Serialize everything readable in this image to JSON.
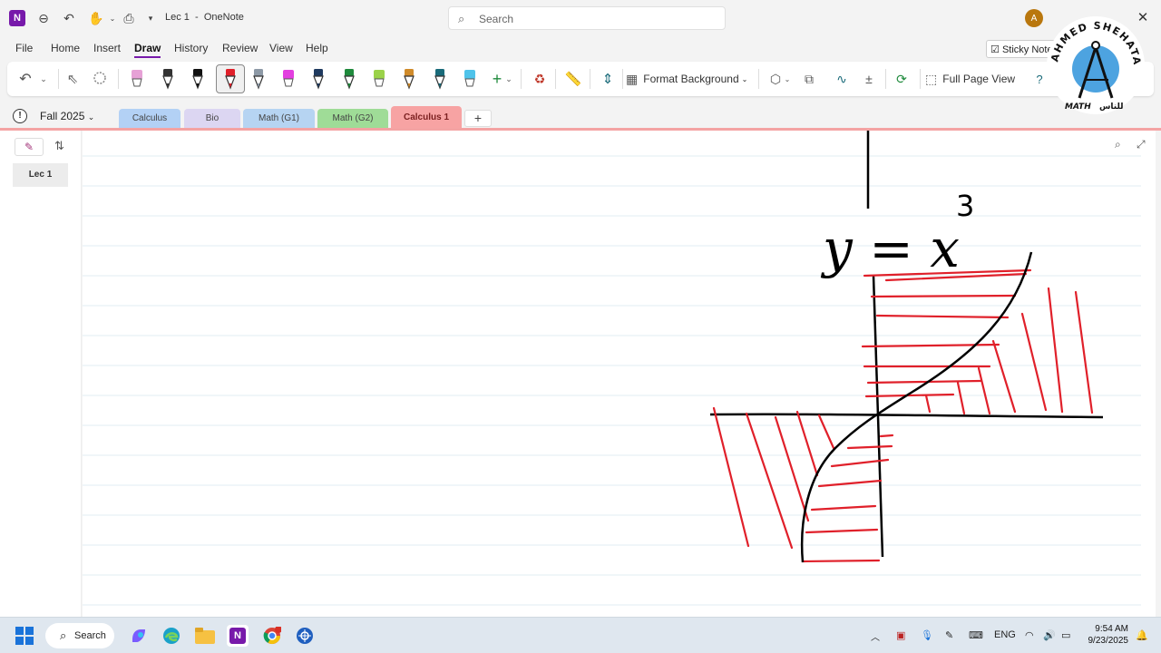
{
  "window": {
    "title": "Lec 1",
    "title_separator": "-",
    "app_name": "OneNote",
    "search_placeholder": "Search",
    "avatar_initial": "A"
  },
  "menu": [
    "File",
    "Home",
    "Insert",
    "Draw",
    "History",
    "Review",
    "View",
    "Help"
  ],
  "active_menu": "Draw",
  "sticky_notes_label": "Sticky Notes",
  "ribbon": {
    "format_background_label": "Format Background",
    "full_page_view_label": "Full Page View",
    "pens": [
      {
        "name": "pink-highlighter",
        "color": "#e6a1d6"
      },
      {
        "name": "black-pen-outline",
        "color": "#333333"
      },
      {
        "name": "black-pen",
        "color": "#111111"
      },
      {
        "name": "red-pen",
        "color": "#e0202a"
      },
      {
        "name": "gray-pen",
        "color": "#8d99a6"
      },
      {
        "name": "magenta-highlighter",
        "color": "#e33fe0"
      },
      {
        "name": "navy-pen",
        "color": "#1f3a5f"
      },
      {
        "name": "green-pen",
        "color": "#1f8a3c"
      },
      {
        "name": "lime-highlighter",
        "color": "#9bd24a"
      },
      {
        "name": "galaxy-pen",
        "color": "#d08b2a"
      },
      {
        "name": "teal-pen",
        "color": "#1a6b7a"
      },
      {
        "name": "cyan-highlighter",
        "color": "#4fc3ea"
      }
    ]
  },
  "notebook": {
    "name": "Fall 2025",
    "sections": [
      {
        "label": "Calculus",
        "color": "#b3d1f5"
      },
      {
        "label": "Bio",
        "color": "#dcd6f2"
      },
      {
        "label": "Math (G1)",
        "color": "#b6d4f2"
      },
      {
        "label": "Math (G2)",
        "color": "#9fdc97"
      },
      {
        "label": "Calculus 1",
        "color": "#f7a3a3"
      }
    ],
    "active_section": "Calculus 1",
    "add_section_label": "+"
  },
  "pages": [
    "Lec 1"
  ],
  "canvas": {
    "formula_main": "y = x",
    "formula_exponent": "3"
  },
  "brand": {
    "name": "AHMED SHEHATA",
    "sub_left": "MATH",
    "sub_right": "للناس"
  },
  "taskbar": {
    "search_label": "Search",
    "language": "ENG",
    "time": "9:54 AM",
    "date": "9/23/2025"
  },
  "colors": {
    "accent": "#7719aa",
    "ink_red": "#e0202a",
    "ink_black": "#000000",
    "rule_line": "#e2ecf3"
  }
}
